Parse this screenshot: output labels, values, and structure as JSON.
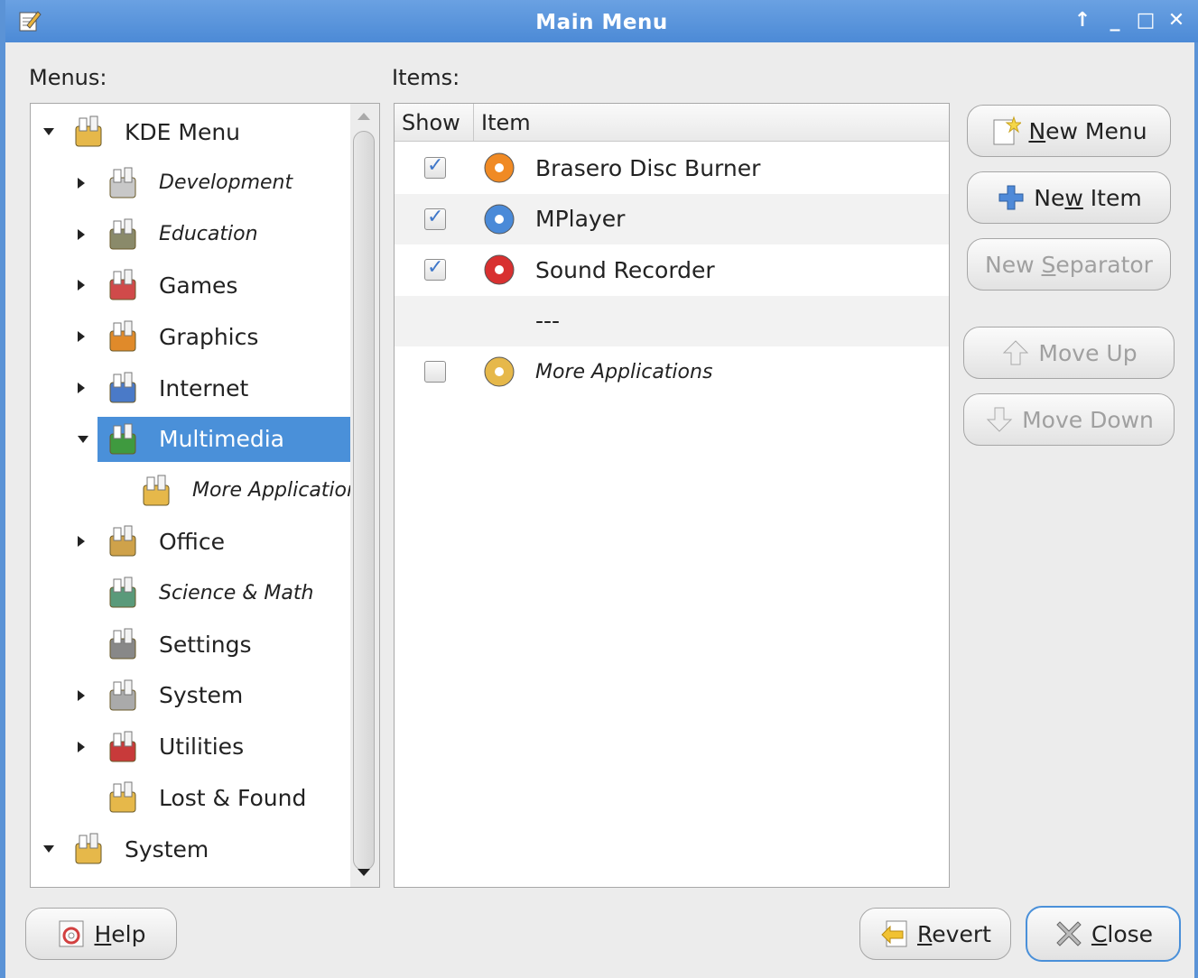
{
  "window": {
    "title": "Main Menu"
  },
  "labels": {
    "menus": "Menus:",
    "items": "Items:"
  },
  "menus_tree": [
    {
      "label": "KDE Menu",
      "icon": "kde-menu-folder-icon",
      "expander": "down",
      "italic": false,
      "level": 0
    },
    {
      "label": "Development",
      "icon": "development-icon",
      "expander": "right",
      "italic": true,
      "level": 1
    },
    {
      "label": "Education",
      "icon": "education-folder-icon",
      "expander": "right",
      "italic": true,
      "level": 1
    },
    {
      "label": "Games",
      "icon": "games-joystick-icon",
      "expander": "right",
      "italic": false,
      "level": 1
    },
    {
      "label": "Graphics",
      "icon": "graphics-palette-icon",
      "expander": "right",
      "italic": false,
      "level": 1
    },
    {
      "label": "Internet",
      "icon": "internet-globe-icon",
      "expander": "right",
      "italic": false,
      "level": 1
    },
    {
      "label": "Multimedia",
      "icon": "multimedia-icon",
      "expander": "down",
      "italic": false,
      "level": 1,
      "selected": true
    },
    {
      "label": "More Applications",
      "icon": "more-applications-icon",
      "expander": "none",
      "italic": true,
      "level": 2
    },
    {
      "label": "Office",
      "icon": "office-icon",
      "expander": "right",
      "italic": false,
      "level": 1
    },
    {
      "label": "Science & Math",
      "icon": "science-icon",
      "expander": "none",
      "italic": true,
      "level": 1
    },
    {
      "label": "Settings",
      "icon": "settings-tools-icon",
      "expander": "none",
      "italic": false,
      "level": 1
    },
    {
      "label": "System",
      "icon": "system-gear-icon",
      "expander": "right",
      "italic": false,
      "level": 1
    },
    {
      "label": "Utilities",
      "icon": "utilities-knife-icon",
      "expander": "right",
      "italic": false,
      "level": 1
    },
    {
      "label": "Lost & Found",
      "icon": "lost-found-icon",
      "expander": "none",
      "italic": false,
      "level": 1
    },
    {
      "label": "System",
      "icon": "system-folder-icon",
      "expander": "down",
      "italic": false,
      "level": 0
    }
  ],
  "items_table": {
    "columns": [
      "Show",
      "Item"
    ],
    "rows": [
      {
        "show": true,
        "label": "Brasero Disc Burner",
        "icon": "brasero-icon",
        "italic": false
      },
      {
        "show": true,
        "label": "MPlayer",
        "icon": "mplayer-icon",
        "italic": false
      },
      {
        "show": true,
        "label": "Sound Recorder",
        "icon": "sound-recorder-icon",
        "italic": false
      },
      {
        "show": null,
        "label": "---",
        "icon": "",
        "italic": false,
        "separator": true
      },
      {
        "show": false,
        "label": "More Applications",
        "icon": "more-applications-icon",
        "italic": true
      }
    ]
  },
  "buttons": {
    "new_menu": {
      "prefix": "",
      "mnemonic": "N",
      "suffix": "ew Menu"
    },
    "new_item": {
      "prefix": "Ne",
      "mnemonic": "w",
      "suffix": " Item"
    },
    "new_separator": {
      "prefix": "New ",
      "mnemonic": "S",
      "suffix": "eparator"
    },
    "move_up": {
      "text": "Move Up"
    },
    "move_down": {
      "text": "Move Down"
    },
    "help": {
      "prefix": "",
      "mnemonic": "H",
      "suffix": "elp"
    },
    "revert": {
      "prefix": "",
      "mnemonic": "R",
      "suffix": "evert"
    },
    "close": {
      "prefix": "",
      "mnemonic": "C",
      "suffix": "lose"
    }
  },
  "colors": {
    "titlebar": "#5b93d6",
    "selection": "#4a90d9",
    "check": "#3f77c9"
  }
}
